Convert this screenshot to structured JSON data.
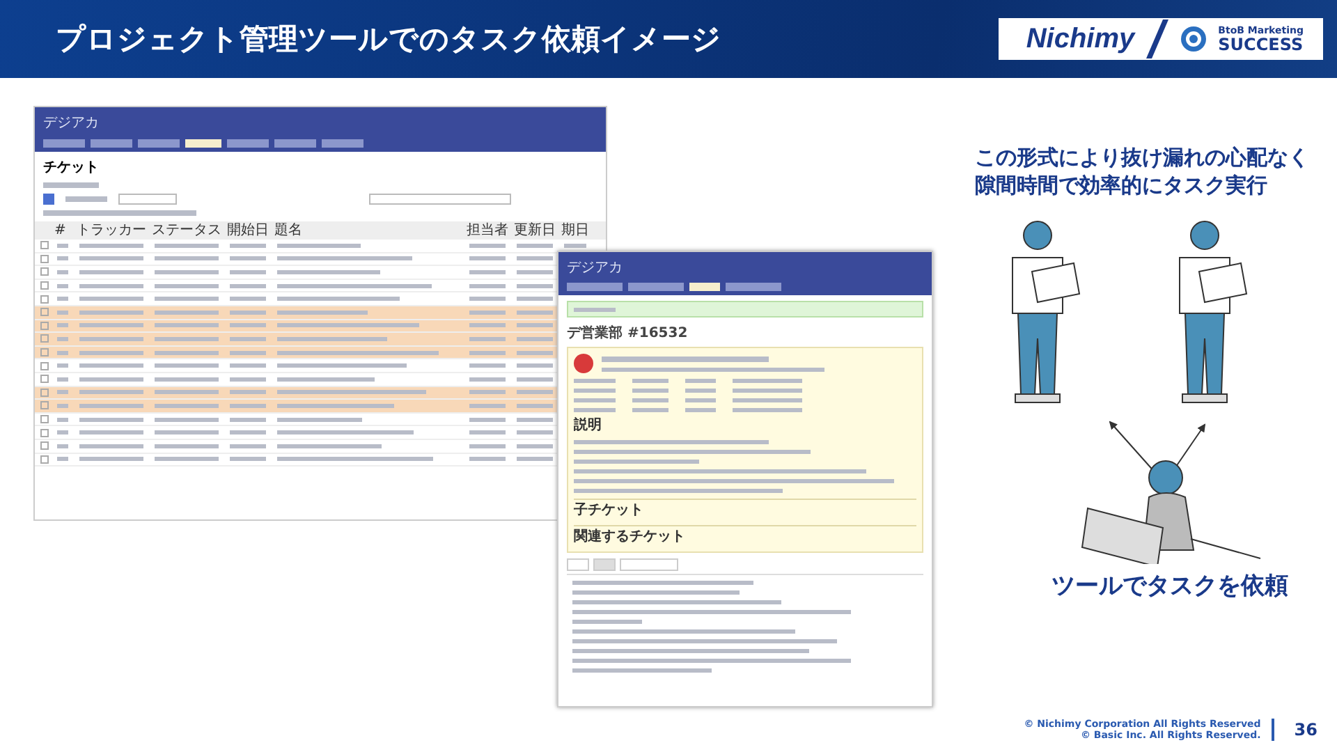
{
  "header": {
    "title": "プロジェクト管理ツールでのタスク依頼イメージ",
    "logo_primary": "Nichimy",
    "logo_secondary_top": "BtoB Marketing",
    "logo_secondary_bottom": "SUCCESS"
  },
  "ticket_list_window": {
    "app_name": "デジアカ",
    "nav_tabs": [
      {
        "selected": false
      },
      {
        "selected": false
      },
      {
        "selected": false
      },
      {
        "selected": true
      },
      {
        "selected": false
      },
      {
        "selected": false
      },
      {
        "selected": false
      }
    ],
    "page_title": "チケット",
    "filter_checked": true,
    "columns": [
      "#",
      "トラッカー",
      "ステータス",
      "開始日",
      "題名",
      "担当者",
      "更新日",
      "期日"
    ],
    "rows": [
      {
        "highlighted": false
      },
      {
        "highlighted": false
      },
      {
        "highlighted": false
      },
      {
        "highlighted": false
      },
      {
        "highlighted": false
      },
      {
        "highlighted": true
      },
      {
        "highlighted": true
      },
      {
        "highlighted": true
      },
      {
        "highlighted": true
      },
      {
        "highlighted": false
      },
      {
        "highlighted": false
      },
      {
        "highlighted": true
      },
      {
        "highlighted": true
      },
      {
        "highlighted": false
      },
      {
        "highlighted": false
      },
      {
        "highlighted": false
      },
      {
        "highlighted": false
      }
    ]
  },
  "ticket_detail_window": {
    "app_name": "デジアカ",
    "nav_tabs": [
      {
        "selected": false
      },
      {
        "selected": false
      },
      {
        "selected": true
      },
      {
        "selected": false
      }
    ],
    "history_tabs": [
      {
        "selected": false
      },
      {
        "selected": true
      },
      {
        "selected": false
      }
    ],
    "ticket_title": "デ営業部 #16532",
    "sections": [
      "説明",
      "子チケット",
      "関連するチケット"
    ]
  },
  "message": {
    "lines": [
      "この形式により抜け漏れの心配なく",
      "隙間時間で効率的にタスク実行"
    ]
  },
  "caption": "ツールでタスクを依頼",
  "footer": {
    "copyrights": [
      "© Nichimy Corporation All Rights Reserved",
      "© Basic Inc. All Rights Reserved."
    ],
    "page_number": "36"
  }
}
